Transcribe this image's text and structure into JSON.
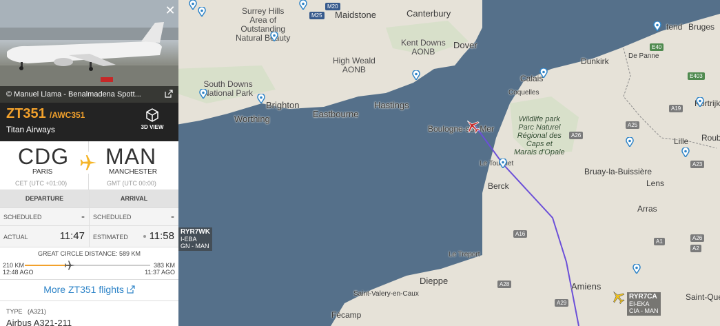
{
  "map": {
    "places": [
      {
        "id": "surrey",
        "text": "Surrey Hills\nArea of\nOutstanding\nNatural Beauty",
        "cls": "aonb"
      },
      {
        "id": "maidstone",
        "text": "Maidstone",
        "cls": "big"
      },
      {
        "id": "canterbury",
        "text": "Canterbury",
        "cls": "big"
      },
      {
        "id": "kentdowns",
        "text": "Kent Downs\nAONB",
        "cls": "aonb"
      },
      {
        "id": "dover",
        "text": "Dover",
        "cls": "big"
      },
      {
        "id": "highweald",
        "text": "High Weald\nAONB",
        "cls": "aonb"
      },
      {
        "id": "southdowns",
        "text": "South Downs\nNational Park",
        "cls": "aonb"
      },
      {
        "id": "brighton",
        "text": "Brighton",
        "cls": "big"
      },
      {
        "id": "worthing",
        "text": "Worthing",
        "cls": "big"
      },
      {
        "id": "eastbourne",
        "text": "Eastbourne",
        "cls": "big"
      },
      {
        "id": "hastings",
        "text": "Hastings",
        "cls": "big"
      },
      {
        "id": "calais",
        "text": "Calais",
        "cls": ""
      },
      {
        "id": "coquelles",
        "text": "Coquelles",
        "cls": ""
      },
      {
        "id": "dunkirk",
        "text": "Dunkirk",
        "cls": ""
      },
      {
        "id": "depanne",
        "text": "De Panne",
        "cls": ""
      },
      {
        "id": "ostend",
        "text": "tend",
        "cls": ""
      },
      {
        "id": "bruges",
        "text": "Bruges",
        "cls": ""
      },
      {
        "id": "boulogne",
        "text": "Boulogne-sur-Mer",
        "cls": ""
      },
      {
        "id": "wildlife",
        "text": "Wildlife park\nParc Naturel\nRégional des\nCaps et\nMarais d'Opale",
        "cls": "park"
      },
      {
        "id": "letouquet",
        "text": "Le Touquet",
        "cls": ""
      },
      {
        "id": "berck",
        "text": "Berck",
        "cls": ""
      },
      {
        "id": "bruay",
        "text": "Bruay-la-Buissière",
        "cls": ""
      },
      {
        "id": "lille",
        "text": "Lille",
        "cls": ""
      },
      {
        "id": "roubai",
        "text": "Roubai",
        "cls": ""
      },
      {
        "id": "kortrijk",
        "text": "Kortrijk",
        "cls": ""
      },
      {
        "id": "lens",
        "text": "Lens",
        "cls": ""
      },
      {
        "id": "arras",
        "text": "Arras",
        "cls": ""
      },
      {
        "id": "letreport",
        "text": "Le Treport",
        "cls": ""
      },
      {
        "id": "dieppe",
        "text": "Dieppe",
        "cls": "big"
      },
      {
        "id": "stvalery",
        "text": "Saint-Valery-en-Caux",
        "cls": ""
      },
      {
        "id": "fecamp",
        "text": "Fécamp",
        "cls": ""
      },
      {
        "id": "amiens",
        "text": "Amiens",
        "cls": "big"
      },
      {
        "id": "stquen",
        "text": "Saint-Quen",
        "cls": ""
      }
    ],
    "roads": [
      {
        "id": "m25",
        "text": "M25",
        "cls": "blue"
      },
      {
        "id": "m20",
        "text": "M20",
        "cls": "blue"
      },
      {
        "id": "e40",
        "text": "E40",
        "cls": "green"
      },
      {
        "id": "e403",
        "text": "E403",
        "cls": "green"
      },
      {
        "id": "a19",
        "text": "A19",
        "cls": ""
      },
      {
        "id": "a25",
        "text": "A25",
        "cls": ""
      },
      {
        "id": "a26",
        "text": "A26",
        "cls": ""
      },
      {
        "id": "a23",
        "text": "A23",
        "cls": ""
      },
      {
        "id": "a16",
        "text": "A16",
        "cls": ""
      },
      {
        "id": "a1",
        "text": "A1",
        "cls": ""
      },
      {
        "id": "a2",
        "text": "A2",
        "cls": ""
      },
      {
        "id": "a26b",
        "text": "A26",
        "cls": ""
      },
      {
        "id": "a28",
        "text": "A28",
        "cls": ""
      },
      {
        "id": "a29",
        "text": "A29",
        "cls": ""
      }
    ],
    "aircraft_labels": [
      {
        "id": "ryr7wk",
        "callsign": "RYR7WK",
        "reg": "I-EBA",
        "route": "GN - MAN"
      },
      {
        "id": "ryr7ca",
        "callsign": "RYR7CA",
        "reg": "EI-EKA",
        "route": "CIA - MAN"
      }
    ]
  },
  "panel": {
    "close_glyph": "✕",
    "photo_credit": "© Manuel Llama - Benalmadena Spott...",
    "flight_number": "ZT351",
    "callsign": "/AWC351",
    "airline": "Titan Airways",
    "view_3d": "3D VIEW",
    "origin": {
      "code": "CDG",
      "city": "PARIS",
      "tz": "CET (UTC +01:00)"
    },
    "destination": {
      "code": "MAN",
      "city": "MANCHESTER",
      "tz": "GMT (UTC 00:00)"
    },
    "departure_head": "DEPARTURE",
    "arrival_head": "ARRIVAL",
    "scheduled_label": "SCHEDULED",
    "scheduled_dep": "-",
    "scheduled_arr": "-",
    "actual_label": "ACTUAL",
    "actual_dep": "11:47",
    "estimated_label": "ESTIMATED",
    "estimated_arr": "11:58",
    "distance_title": "GREAT CIRCLE DISTANCE: 589 KM",
    "dist_left_km": "210 KM",
    "dist_left_ago": "12:48 AGO",
    "dist_right_km": "383 KM",
    "dist_right_ago": "11:37 AGO",
    "progress_fraction": 0.356,
    "more_flights": "More ZT351 flights",
    "type_label": "TYPE",
    "type_code": "(A321)",
    "type_name": "Airbus A321-211"
  },
  "colors": {
    "accent": "#f2a12c",
    "link": "#2e84c8",
    "track": "#6b4fd8",
    "sea": "#55708a",
    "land": "#e6e2d8"
  }
}
